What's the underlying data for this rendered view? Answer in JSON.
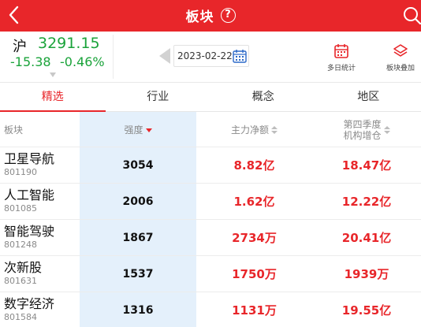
{
  "header": {
    "title": "板块",
    "help_symbol": "?"
  },
  "index": {
    "name": "沪",
    "price": "3291.15",
    "change": "-15.38",
    "change_pct": "-0.46%"
  },
  "date": {
    "value": "2023-02-22"
  },
  "tools": {
    "multi_day_label": "多日统计",
    "overlay_label": "板块叠加"
  },
  "tabs": [
    {
      "label": "精选",
      "active": true
    },
    {
      "label": "行业",
      "active": false
    },
    {
      "label": "概念",
      "active": false
    },
    {
      "label": "地区",
      "active": false
    }
  ],
  "table": {
    "headers": {
      "name": "板块",
      "strength": "强度",
      "net_inflow": "主力净额",
      "inst_line1": "第四季度",
      "inst_line2": "机构增仓"
    },
    "rows": [
      {
        "name": "卫星导航",
        "code": "801190",
        "strength": "3054",
        "net_inflow": "8.82亿",
        "inst": "18.47亿"
      },
      {
        "name": "人工智能",
        "code": "801085",
        "strength": "2006",
        "net_inflow": "1.62亿",
        "inst": "12.22亿"
      },
      {
        "name": "智能驾驶",
        "code": "801248",
        "strength": "1867",
        "net_inflow": "2734万",
        "inst": "20.41亿"
      },
      {
        "name": "次新股",
        "code": "801631",
        "strength": "1537",
        "net_inflow": "1750万",
        "inst": "1939万"
      },
      {
        "name": "数字经济",
        "code": "801584",
        "strength": "1316",
        "net_inflow": "1131万",
        "inst": "19.55亿"
      }
    ]
  },
  "colors": {
    "brand_red": "#e8262a",
    "down_green": "#1aa33a",
    "highlight_column": "#e4f0fb"
  }
}
